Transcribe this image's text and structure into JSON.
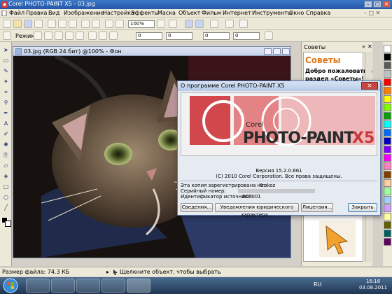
{
  "window": {
    "title": "Corel PHOTO-PAINT X5 - 03.jpg"
  },
  "menu": [
    "Файл",
    "Правка",
    "Вид",
    "Изображение",
    "Настройка",
    "Эффекты",
    "Маска",
    "Объект",
    "Фильм",
    "Интернет",
    "Инструменты",
    "Окно",
    "Справка"
  ],
  "toolbar": {
    "zoom_value": "100%",
    "mode_label": "Режим",
    "field_values": [
      "0",
      "0",
      "0",
      "0"
    ]
  },
  "document": {
    "title": "03.jpg (RGB 24 бит) @100% - Фон"
  },
  "dialog": {
    "title": "О программе Corel PHOTO-PAINT X5",
    "brand_small": "Corel",
    "brand_large": "PHOTO-PAINT",
    "brand_version": "X5",
    "version_line": "Версия 15.2.0.661",
    "copyright_line": "(C) 2010 Corel Corporation. Все права защищены.",
    "info_labels": [
      "Эта копия зарегистрирована на::",
      "Серийный номер:",
      "Идентификатор источника:"
    ],
    "info_values": [
      "Krokoz",
      "",
      "807001"
    ],
    "buttons": [
      "Сведения...",
      "Уведомления юридического характера...",
      "Лицензия...",
      "Закрыть"
    ]
  },
  "docker": {
    "tab_title": "Советы",
    "heading": "Советы",
    "welcome": [
      "Добро пожаловать в",
      "раздел «Советы»!"
    ]
  },
  "status": {
    "file_size": "Размер файла: 74.3 КБ",
    "hint": "Щелкните объект, чтобы выбрать"
  },
  "taskbar": {
    "lang": "RU",
    "time": "16:16",
    "date": "03.08.2011"
  },
  "colors": {
    "accent_blue": "#2556a8",
    "banner_red": "#c8383d",
    "palette": [
      "#ffffff",
      "#000000",
      "#5a5a5a",
      "#c0c0c0",
      "#ff0000",
      "#ff7f00",
      "#ffff00",
      "#7fff00",
      "#00a000",
      "#00ffff",
      "#0070ff",
      "#0000c0",
      "#8000ff",
      "#ff00ff",
      "#ff80c0",
      "#804000",
      "#ffd0a0",
      "#a0ffa0",
      "#a0d0ff",
      "#d0a0ff",
      "#ffffa0",
      "#606000",
      "#006060",
      "#600060"
    ]
  }
}
